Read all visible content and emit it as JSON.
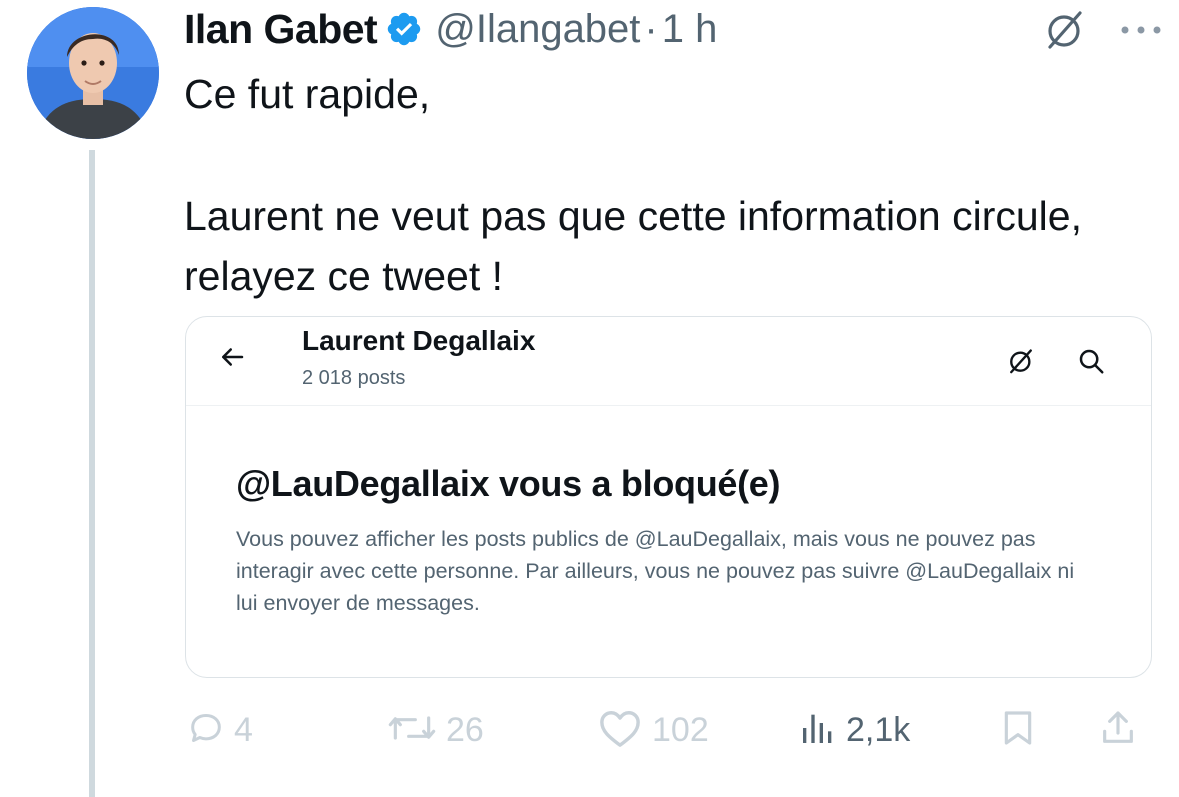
{
  "tweet": {
    "author_name": "Ilan Gabet",
    "author_handle": "@Ilangabet",
    "time_sep": "·",
    "time": "1 h",
    "text_line1": "Ce fut rapide,",
    "text_line2": "Laurent ne veut pas que cette information circule, relayez ce tweet !"
  },
  "icons": {
    "verified": "verified-badge-icon",
    "grok": "grok-icon",
    "more": "more-icon",
    "back": "back-arrow-icon",
    "search": "search-icon",
    "reply": "reply-icon",
    "retweet": "retweet-icon",
    "like": "like-icon",
    "views": "views-icon",
    "bookmark": "bookmark-icon",
    "share": "share-icon"
  },
  "colors": {
    "verified": "#1d9bf0",
    "text": "#0f1419",
    "secondary": "#536471",
    "faded": "#c9d2d9"
  },
  "embedded_screenshot": {
    "profile_name": "Laurent Degallaix",
    "post_count": "2 018 posts",
    "blocked_title": "@LauDegallaix vous a bloqué(e)",
    "blocked_description": "Vous pouvez afficher les posts publics de @LauDegallaix, mais vous ne pouvez pas interagir avec cette personne. Par ailleurs, vous ne pouvez pas suivre @LauDegallaix ni lui envoyer de messages."
  },
  "actions": {
    "replies": "4",
    "retweets": "26",
    "likes": "102",
    "views": "2,1k"
  }
}
